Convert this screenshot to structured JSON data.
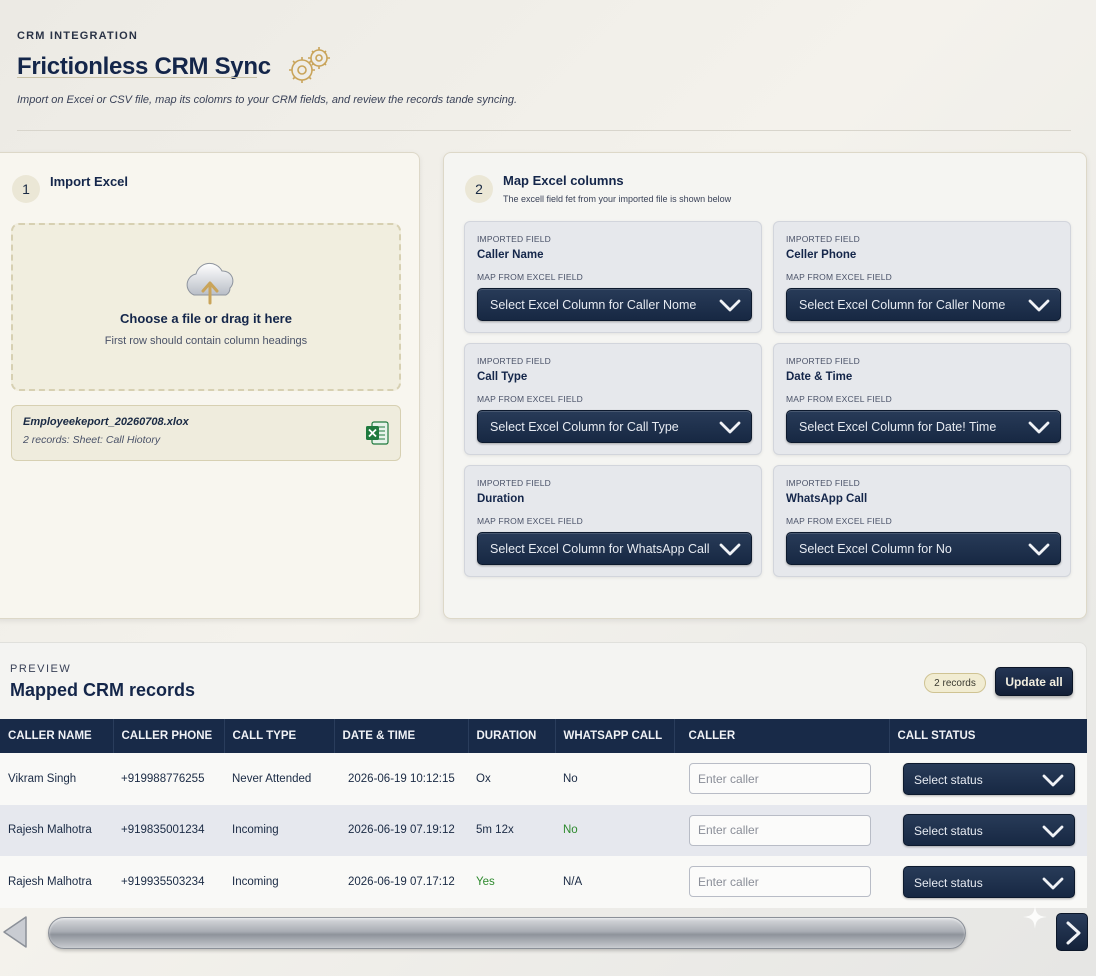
{
  "header": {
    "eyebrow": "CRM INTEGRATION",
    "title": "Frictionless CRM Sync",
    "subtitle": "Import on Excei or CSV file, map its colomrs to your CRM fields, and review the records tande syncing."
  },
  "import_panel": {
    "step": "1",
    "title": "Import Excel",
    "dropzone_title": "Choose a file or drag it here",
    "dropzone_sub": "First row should contain column headings",
    "file_name": "Employeekeport_20260708.xlox",
    "file_meta": "2 records: Sheet: Call Hiotory"
  },
  "map_panel": {
    "step": "2",
    "title": "Map Excel columns",
    "subtitle": "The excell field fet from your imported file is shown below",
    "imported_label": "IMPORTED FIELD",
    "map_label": "MAP FROM EXCEL FIELD",
    "cards": [
      {
        "field": "Caller Name",
        "select": "Select Excel Column for Caller Nome"
      },
      {
        "field": "Celler Phone",
        "select": "Select Excel Column for Caller Nome"
      },
      {
        "field": "Call Type",
        "select": "Select Excel Column for Call Type"
      },
      {
        "field": "Date & Time",
        "select": "Select Excel Column for Date! Time"
      },
      {
        "field": "Duration",
        "select": "Select Excel Column for WhatsApp Call"
      },
      {
        "field": "WhatsApp Call",
        "select": "Select Excel Column for No"
      }
    ]
  },
  "preview": {
    "eyebrow": "PREVIEW",
    "title": "Mapped CRM records",
    "badge": "2 records",
    "update_button": "Update all",
    "columns": [
      "CALLER NAME",
      "CALLER PHONE",
      "CALL TYPE",
      "DATE & TIME",
      "DURATION",
      "WHATSAPP CALL",
      "CALLER",
      "CALL STATUS"
    ],
    "caller_placeholder": "Enter caller",
    "status_placeholder": "Select status",
    "rows": [
      {
        "name": "Vikram Singh",
        "phone": "+919988776255",
        "type": "Never Attended",
        "datetime": "2026-06-19 10:12:15",
        "duration": "Ox",
        "whatsapp": "No"
      },
      {
        "name": "Rajesh Malhotra",
        "phone": "+919835001234",
        "type": "Incoming",
        "datetime": "2026-06-19 07.19:12",
        "duration": "5m 12x",
        "whatsapp": "No"
      },
      {
        "name": "Rajesh Malhotra",
        "phone": "+919935503234",
        "type": "Incoming",
        "datetime": "2026-06-19 07.17:12",
        "duration": "Yes",
        "whatsapp": "N/A"
      }
    ]
  },
  "colors": {
    "navy": "#182a48",
    "accent_green": "#2e8a2e",
    "gold": "#c9a45a"
  }
}
